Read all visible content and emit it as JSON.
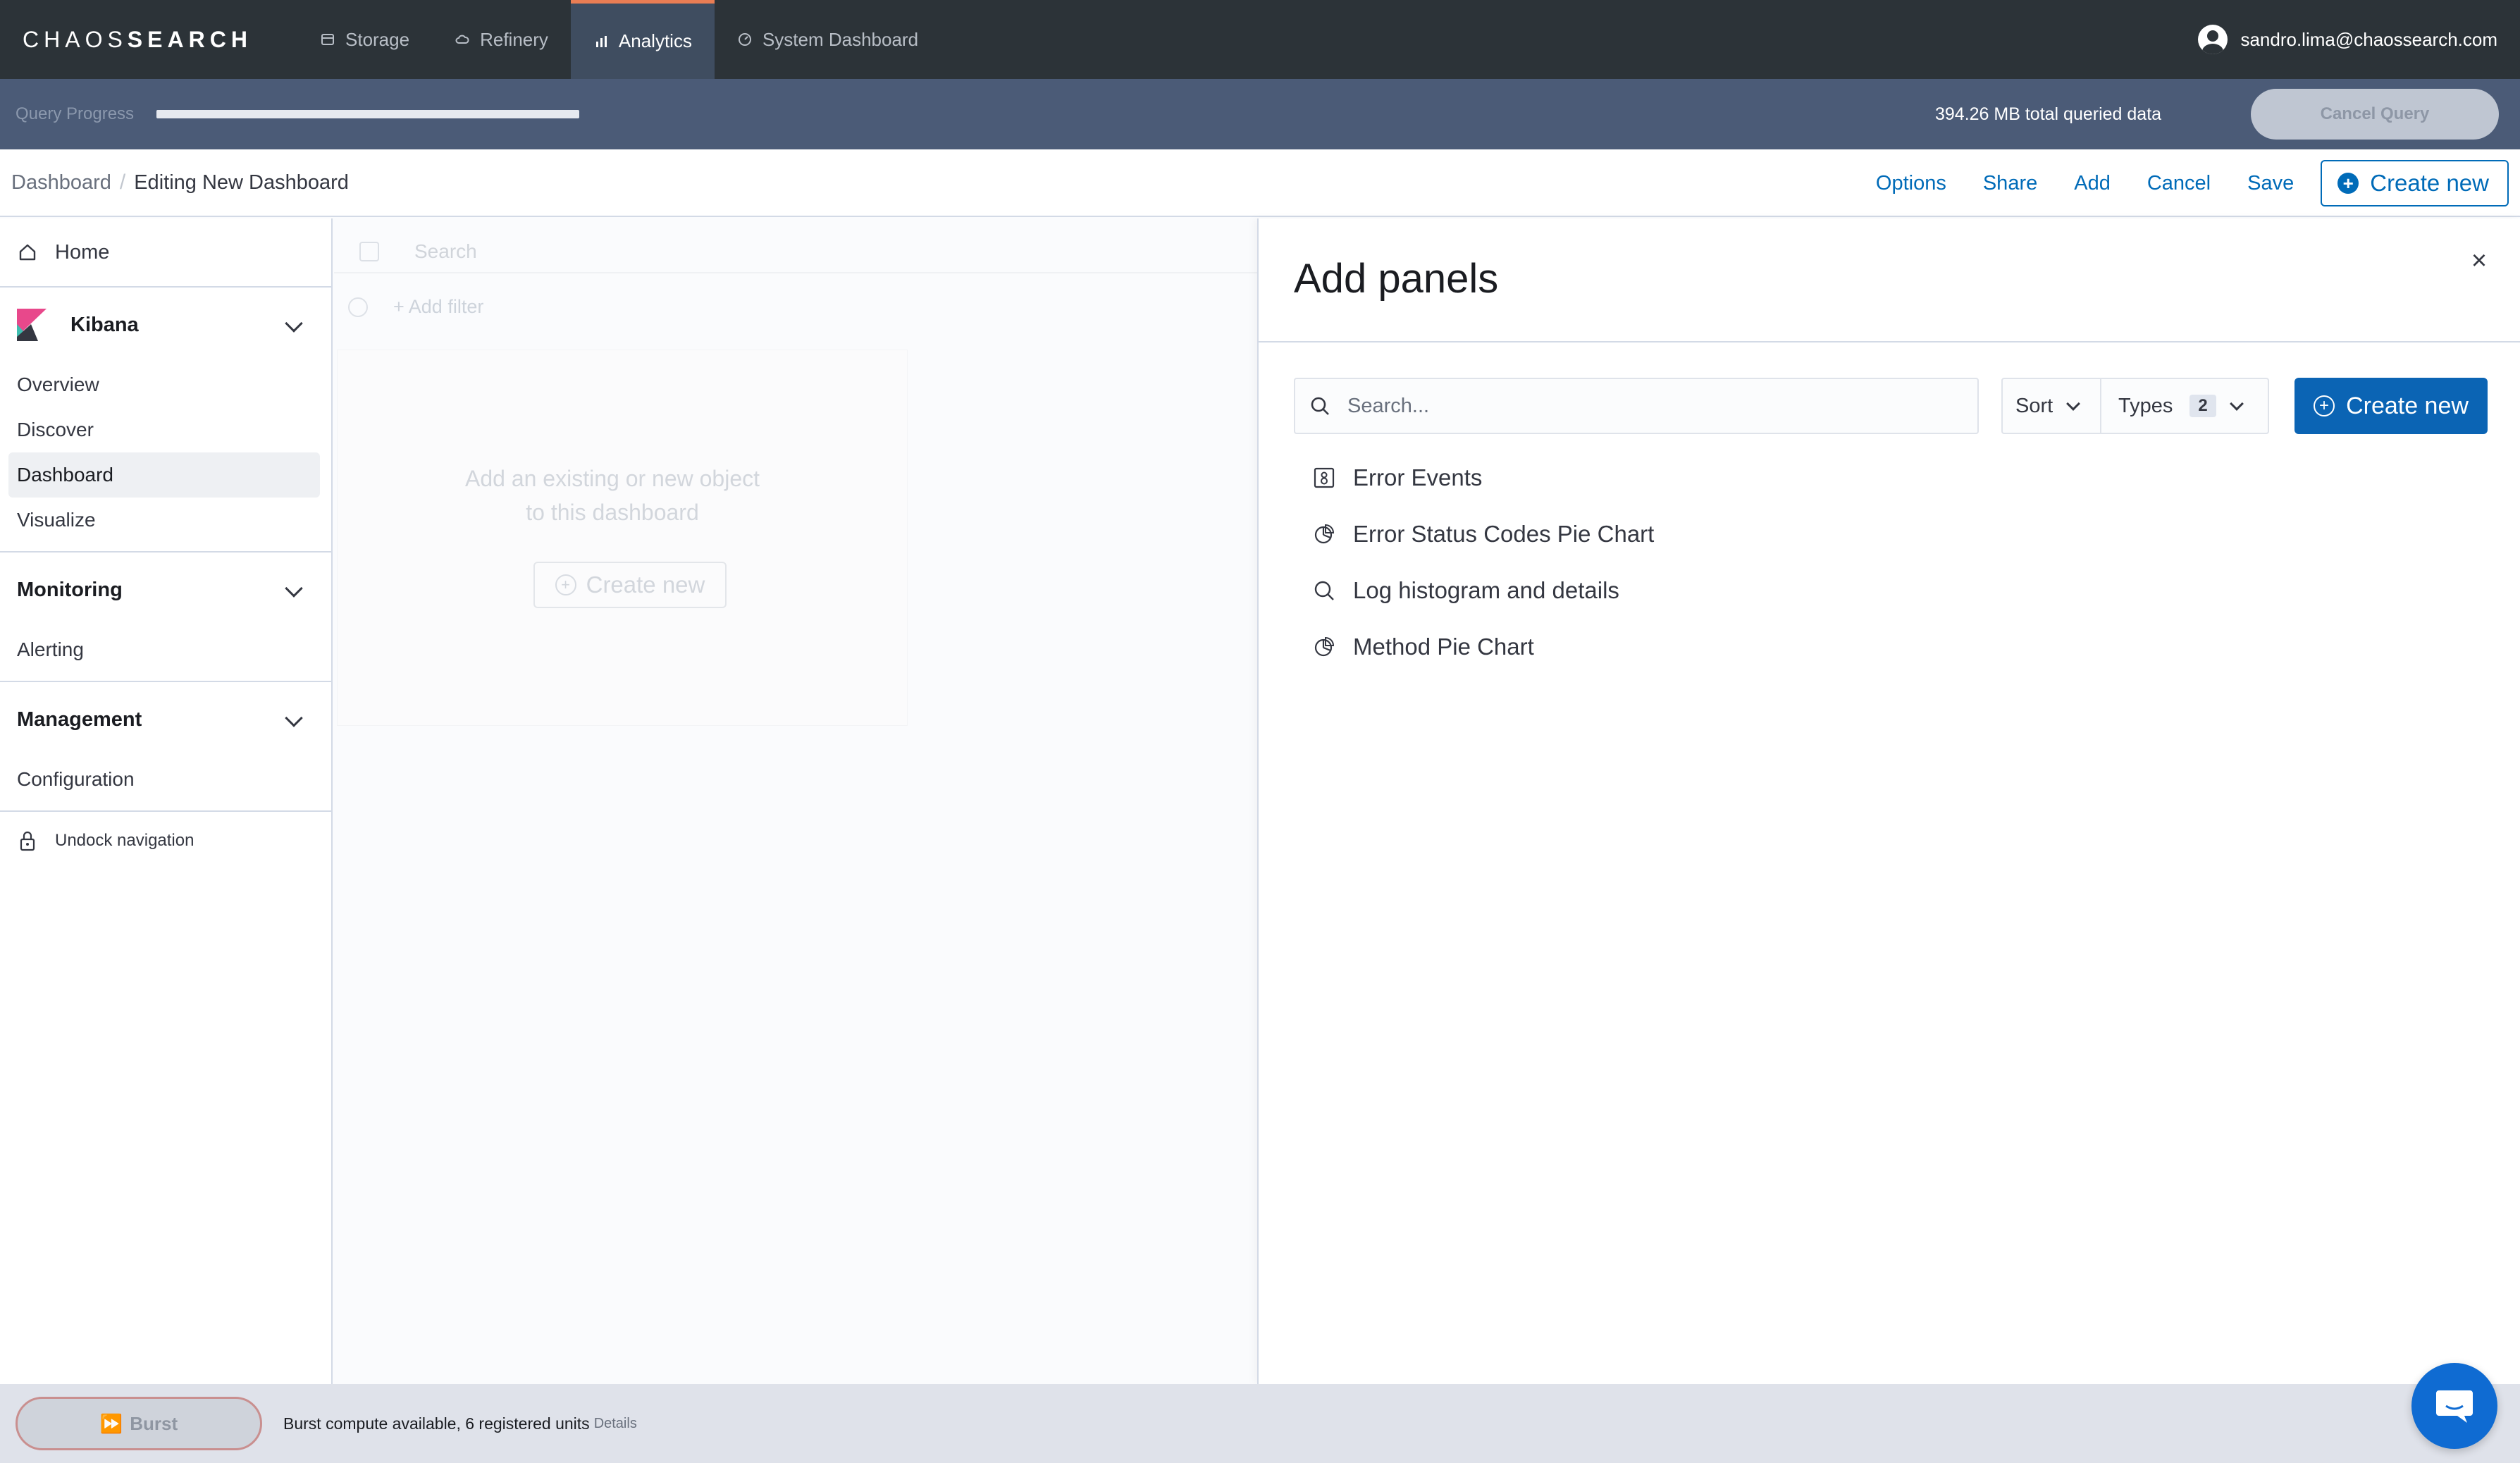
{
  "app": {
    "logo_light": "CHAOS",
    "logo_bold": "SEARCH"
  },
  "topnav": {
    "tabs": [
      {
        "label": "Storage",
        "icon": "storage-icon",
        "active": false
      },
      {
        "label": "Refinery",
        "icon": "cloud-icon",
        "active": false
      },
      {
        "label": "Analytics",
        "icon": "bar-chart-icon",
        "active": true
      },
      {
        "label": "System Dashboard",
        "icon": "dashboard-icon",
        "active": false
      }
    ],
    "user_email": "sandro.lima@chaossearch.com"
  },
  "query": {
    "label": "Query Progress",
    "progress": 1.0,
    "total": "394.26 MB total queried data",
    "cancel_label": "Cancel Query"
  },
  "breadcrumb": {
    "root": "Dashboard",
    "current": "Editing New Dashboard"
  },
  "actions": {
    "options": "Options",
    "share": "Share",
    "add": "Add",
    "cancel": "Cancel",
    "save": "Save",
    "create_new": "Create new"
  },
  "sidebar": {
    "home": "Home",
    "kibana": {
      "title": "Kibana",
      "items": [
        "Overview",
        "Discover",
        "Dashboard",
        "Visualize"
      ],
      "active": "Dashboard"
    },
    "monitoring": {
      "title": "Monitoring",
      "items": [
        "Alerting"
      ]
    },
    "management": {
      "title": "Management",
      "items": [
        "Configuration"
      ]
    },
    "undock": "Undock navigation"
  },
  "canvas": {
    "search_placeholder": "Search",
    "add_filter": "+ Add filter",
    "empty_line1": "Add an existing or new object",
    "empty_line2": "to this dashboard",
    "create_new": "Create new"
  },
  "flyout": {
    "title": "Add panels",
    "search_placeholder": "Search...",
    "sort_label": "Sort",
    "types_label": "Types",
    "types_count": "2",
    "create_new": "Create new",
    "panels": [
      {
        "label": "Error Events",
        "icon": "saved-search-icon"
      },
      {
        "label": "Error Status Codes Pie Chart",
        "icon": "pie-chart-icon"
      },
      {
        "label": "Log histogram and details",
        "icon": "search-icon"
      },
      {
        "label": "Method Pie Chart",
        "icon": "pie-chart-icon"
      }
    ]
  },
  "footer": {
    "burst_label": "Burst",
    "status": "Burst compute available, 6 registered units",
    "details": "Details"
  }
}
